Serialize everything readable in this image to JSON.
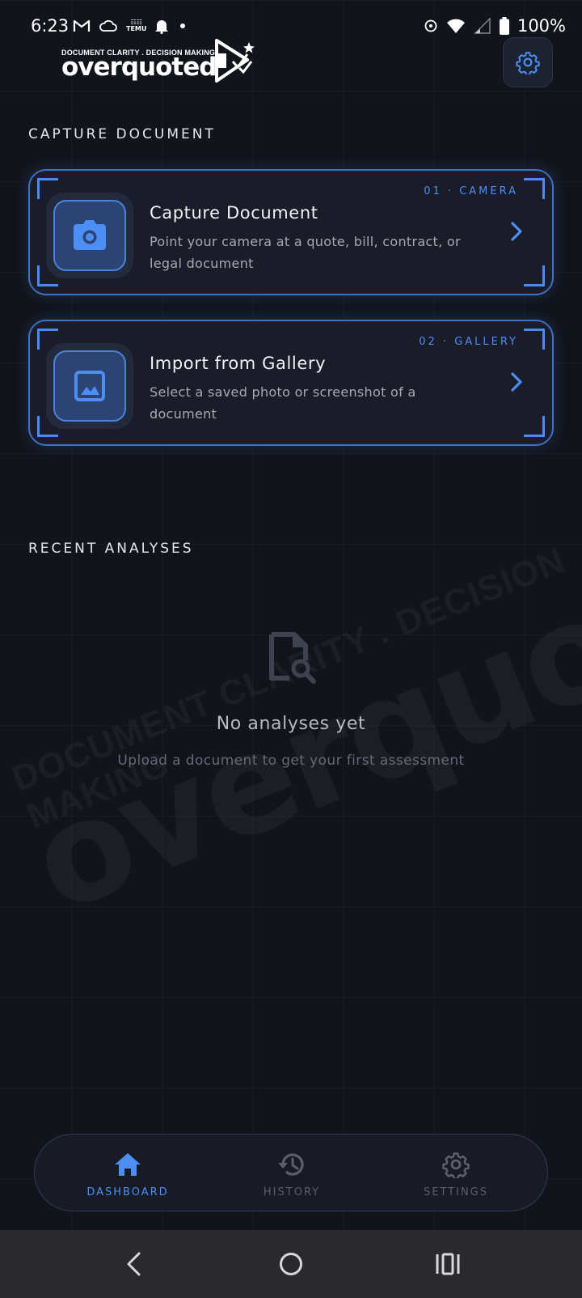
{
  "status_bar": {
    "time": "6:23",
    "battery": "100%",
    "left_icons": [
      "gmail-icon",
      "cloud-icon",
      "temu-icon",
      "bell-icon",
      "dot-icon"
    ],
    "right_icons": [
      "hotspot-icon",
      "wifi-icon",
      "signal-icon",
      "battery-icon"
    ]
  },
  "header": {
    "logo_tagline": "DOCUMENT CLARITY . DECISION MAKING",
    "logo_word": "overquoted",
    "settings_icon": "gear-icon"
  },
  "capture": {
    "section_title": "CAPTURE DOCUMENT",
    "cards": [
      {
        "tag": "01 · CAMERA",
        "title": "Capture Document",
        "description": "Point your camera at a quote, bill, contract, or legal document",
        "icon": "camera-icon"
      },
      {
        "tag": "02 · GALLERY",
        "title": "Import from Gallery",
        "description": "Select a saved photo or screenshot of a document",
        "icon": "image-icon"
      }
    ]
  },
  "recent": {
    "section_title": "RECENT ANALYSES",
    "empty_title": "No analyses yet",
    "empty_description": "Upload a document to get your first assessment"
  },
  "bottom_nav": {
    "items": [
      {
        "label": "DASHBOARD",
        "icon": "home-icon",
        "active": true
      },
      {
        "label": "HISTORY",
        "icon": "history-icon",
        "active": false
      },
      {
        "label": "SETTINGS",
        "icon": "gear-icon",
        "active": false
      }
    ]
  },
  "colors": {
    "background": "#12141b",
    "accent": "#4d8ef5",
    "card_border": "#3f6fc2",
    "muted_text": "#646877"
  }
}
